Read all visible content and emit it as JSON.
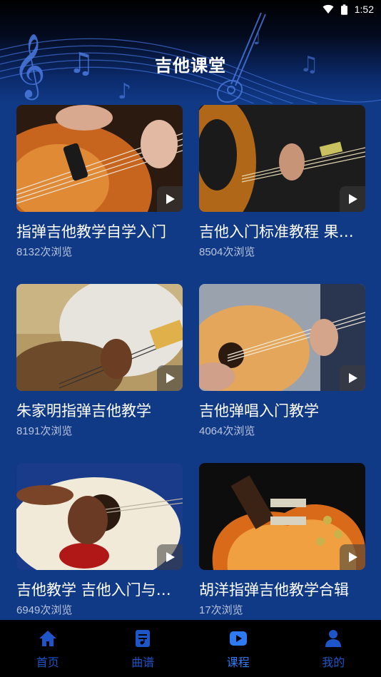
{
  "status_bar": {
    "time": "1:52"
  },
  "header": {
    "title": "吉他课堂"
  },
  "courses": [
    {
      "title": "指弹吉他教学自学入门",
      "views": "8132次浏览"
    },
    {
      "title": "吉他入门标准教程 果木浪子",
      "views": "8504次浏览"
    },
    {
      "title": "朱家明指弹吉他教学",
      "views": "8191次浏览"
    },
    {
      "title": "吉他弹唱入门教学",
      "views": "4064次浏览"
    },
    {
      "title": "吉他教学 吉他入门与提高",
      "views": "6949次浏览"
    },
    {
      "title": "胡洋指弹吉他教学合辑",
      "views": "17次浏览"
    }
  ],
  "bottom_nav": [
    {
      "label": "首页",
      "icon": "home-icon"
    },
    {
      "label": "曲谱",
      "icon": "sheet-music-icon"
    },
    {
      "label": "课程",
      "icon": "play-video-icon",
      "active": true
    },
    {
      "label": "我的",
      "icon": "user-icon"
    }
  ],
  "colors": {
    "background": "#103a86",
    "nav_active": "#2f7af2",
    "nav_inactive": "#1e55c8"
  }
}
